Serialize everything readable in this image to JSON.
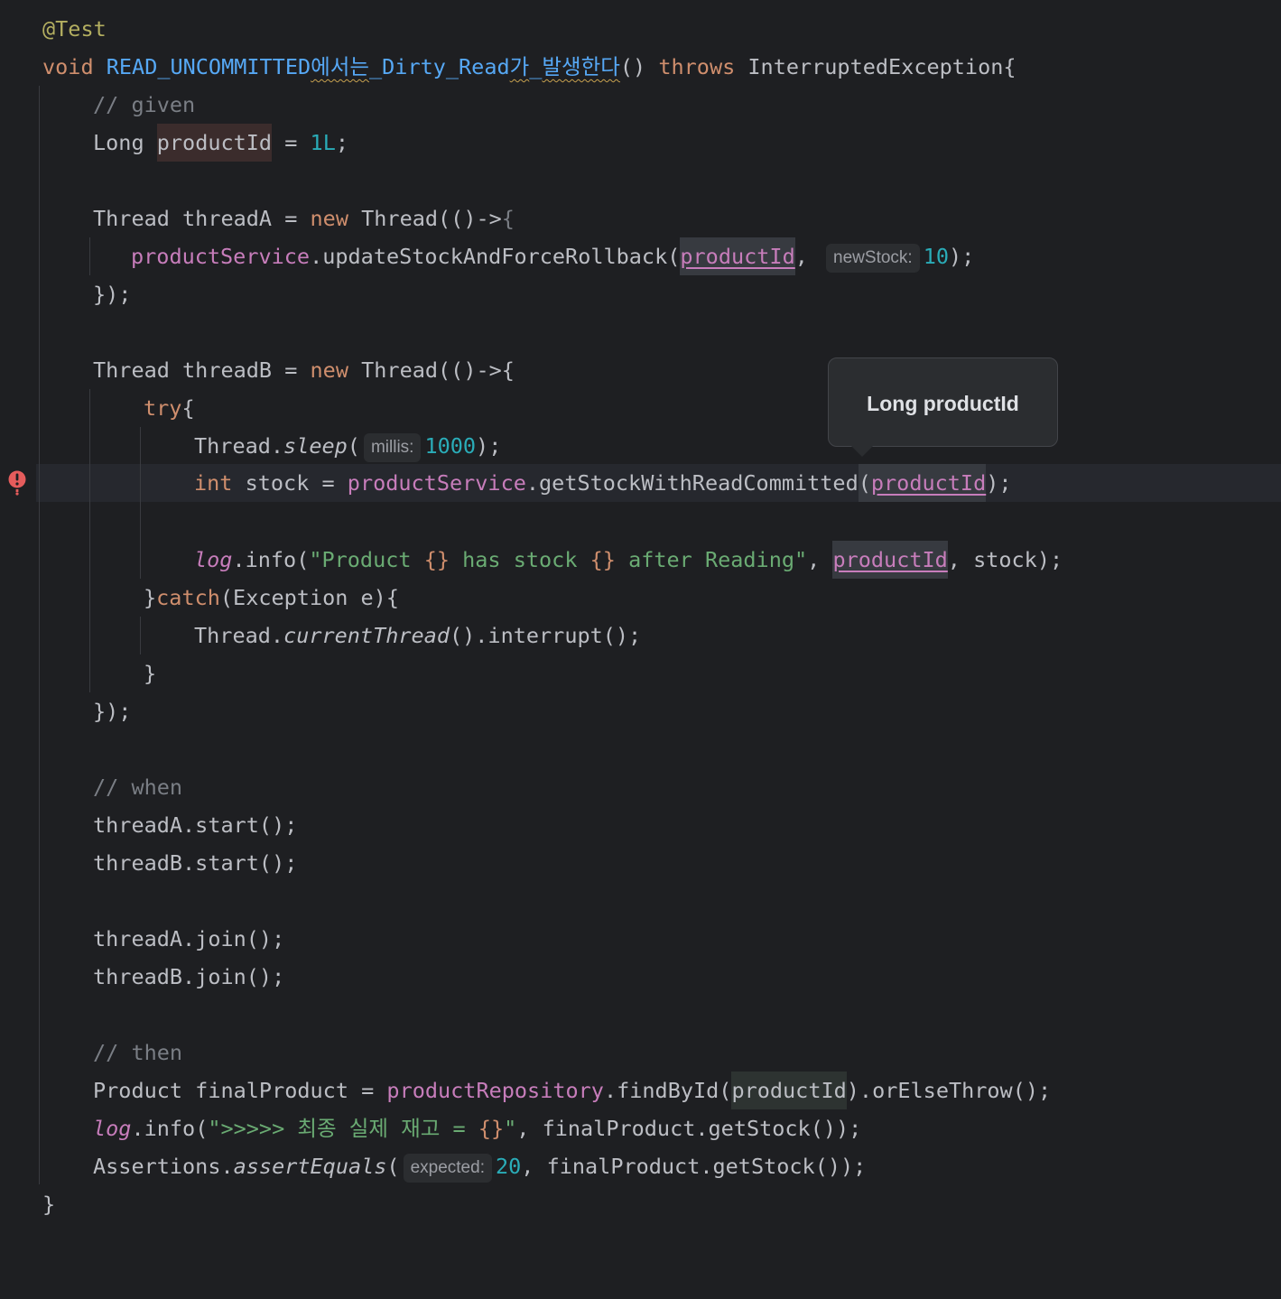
{
  "editor": {
    "lines": {
      "l1": {
        "annotation": "@Test"
      },
      "l2": {
        "kw_void": "void ",
        "method_name_a": "READ_UNCOMMITTED",
        "method_name_b": "에서는",
        "method_name_c": "_Dirty_Read",
        "method_name_d": "가",
        "method_name_e": "_",
        "method_name_f": "발생한다",
        "params": "() ",
        "kw_throws": "throws",
        "exception": " InterruptedException{"
      },
      "l3": {
        "comment": "// given"
      },
      "l4": {
        "type": "Long ",
        "var": "productId",
        "eq": " = ",
        "value": "1L",
        "semi": ";"
      },
      "l6": {
        "decl": "Thread threadA = ",
        "kw_new": "new",
        "ctor": " Thread(()->",
        "brace": "{"
      },
      "l7": {
        "field": "productService",
        "call": ".updateStockAndForceRollback(",
        "arg": "productId",
        "comma": ",",
        "hint": "newStock:",
        "value": "10",
        "end": ");"
      },
      "l8": {
        "text": "});"
      },
      "l10": {
        "decl": "Thread threadB = ",
        "kw_new": "new",
        "ctor": " Thread(()->{"
      },
      "l11": {
        "kw_try": "try",
        "brace": "{"
      },
      "l12": {
        "cls": "Thread.",
        "method": "sleep",
        "open": "(",
        "hint": "millis:",
        "value": "1000",
        "end": ");"
      },
      "l13": {
        "kw_int": "int",
        "decl": " stock = ",
        "field": "productService",
        "call": ".getStockWithReadCommitted",
        "open": "(",
        "arg": "productId",
        "end": ");"
      },
      "l15": {
        "field": "log",
        "call": ".info(",
        "str_a": "\"Product ",
        "ph1": "{}",
        "str_b": " has stock ",
        "ph2": "{}",
        "str_c": " after Reading\"",
        "comma": ", ",
        "arg": "productId",
        "end": ", stock);"
      },
      "l16": {
        "brace": "}",
        "kw_catch": "catch",
        "rest": "(Exception e){"
      },
      "l17": {
        "cls": "Thread.",
        "method": "currentThread",
        "rest": "().interrupt();"
      },
      "l18": {
        "text": "}"
      },
      "l19": {
        "text": "});"
      },
      "l21": {
        "comment": "// when"
      },
      "l22": {
        "text": "threadA.start();"
      },
      "l23": {
        "text": "threadB.start();"
      },
      "l25": {
        "text": "threadA.join();"
      },
      "l26": {
        "text": "threadB.join();"
      },
      "l28": {
        "comment": "// then"
      },
      "l29": {
        "decl": "Product finalProduct = ",
        "field": "productRepository",
        "call": ".findById(",
        "arg": "productId",
        "end": ").orElseThrow();"
      },
      "l30": {
        "field": "log",
        "call": ".info(",
        "str_a": "\">>>>> 최종 실제 재고 = ",
        "ph": "{}",
        "str_b": "\"",
        "end": ", finalProduct.getStock());"
      },
      "l31": {
        "cls": "Assertions.",
        "method": "assertEquals",
        "open": "(",
        "hint": "expected:",
        "value": "20",
        "end": ", finalProduct.getStock());"
      },
      "l32": {
        "text": "}"
      }
    },
    "tooltip": {
      "text": "Long productId"
    },
    "gutter": {
      "error_icon": "error-icon"
    },
    "colors": {
      "background": "#1e1f22",
      "keyword": "#cf8e6d",
      "method_decl": "#56a8f5",
      "field": "#c77dbb",
      "string": "#6aab73",
      "number": "#2aacb8",
      "comment": "#7a7e85",
      "annotation": "#b3ae60",
      "error": "#e55c5c"
    }
  }
}
